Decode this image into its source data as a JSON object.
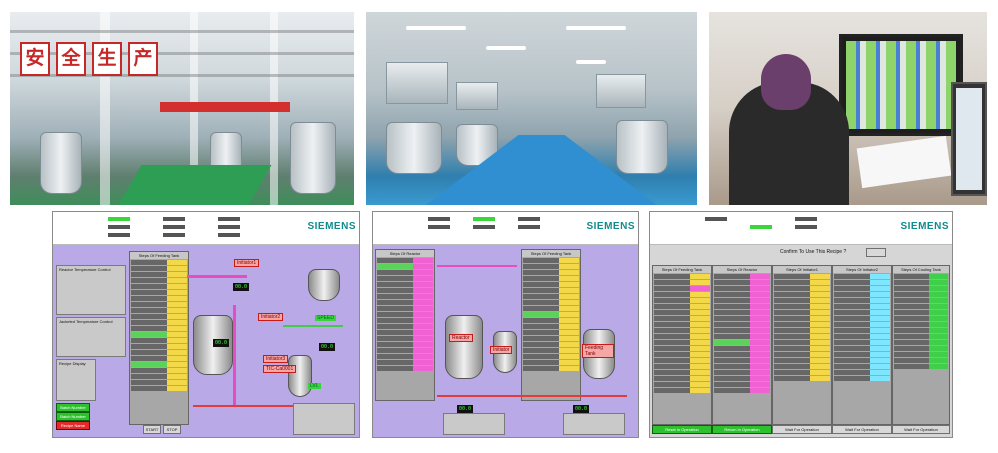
{
  "photos": {
    "banner_chars": [
      "安",
      "全",
      "生",
      "产"
    ]
  },
  "screen1": {
    "brand": "SIEMENS",
    "seq_title": "Steps Of Feeding Tank",
    "tag_a": "Initiator1",
    "tag_b": "Initiator2",
    "tag_c": "Initiator3",
    "tag_d": "TIC-Ca0001",
    "tag_speed": "SPEED",
    "tag_level": "LVL",
    "display_1": "00.0",
    "display_2": "00.0",
    "display_3": "00.0",
    "left_panel_title": "Reactor Temperature Control",
    "left_panel_title2": "Jacketed Temperature Control",
    "recipe_title": "Recipe Display",
    "red_buttons": [
      "Batch Number",
      "Batch Number",
      "Recipe Name"
    ],
    "green_buttons": [
      "START",
      "STOP"
    ]
  },
  "screen2": {
    "brand": "SIEMENS",
    "seq_title_left": "Steps Of Reactor",
    "seq_title_right": "Steps Of Feeding Tank",
    "tank_labels": [
      "Reactor",
      "Initiator",
      "Feeding Tank"
    ],
    "display_1": "00.0",
    "display_2": "00.0"
  },
  "screen3": {
    "brand": "SIEMENS",
    "confirm_text": "Confirm To Use This Recipe ?",
    "column_titles": [
      "Steps Of Feeding Tank",
      "Steps Of Reactor",
      "Steps Of Initiator1",
      "Steps Of Initiator2",
      "Steps Of Cooling Tank"
    ],
    "status_texts": [
      "Reset In Operation",
      "Return In Operation",
      "Wait For Operation",
      "Wait For Operation",
      "Wait For Operation"
    ]
  }
}
